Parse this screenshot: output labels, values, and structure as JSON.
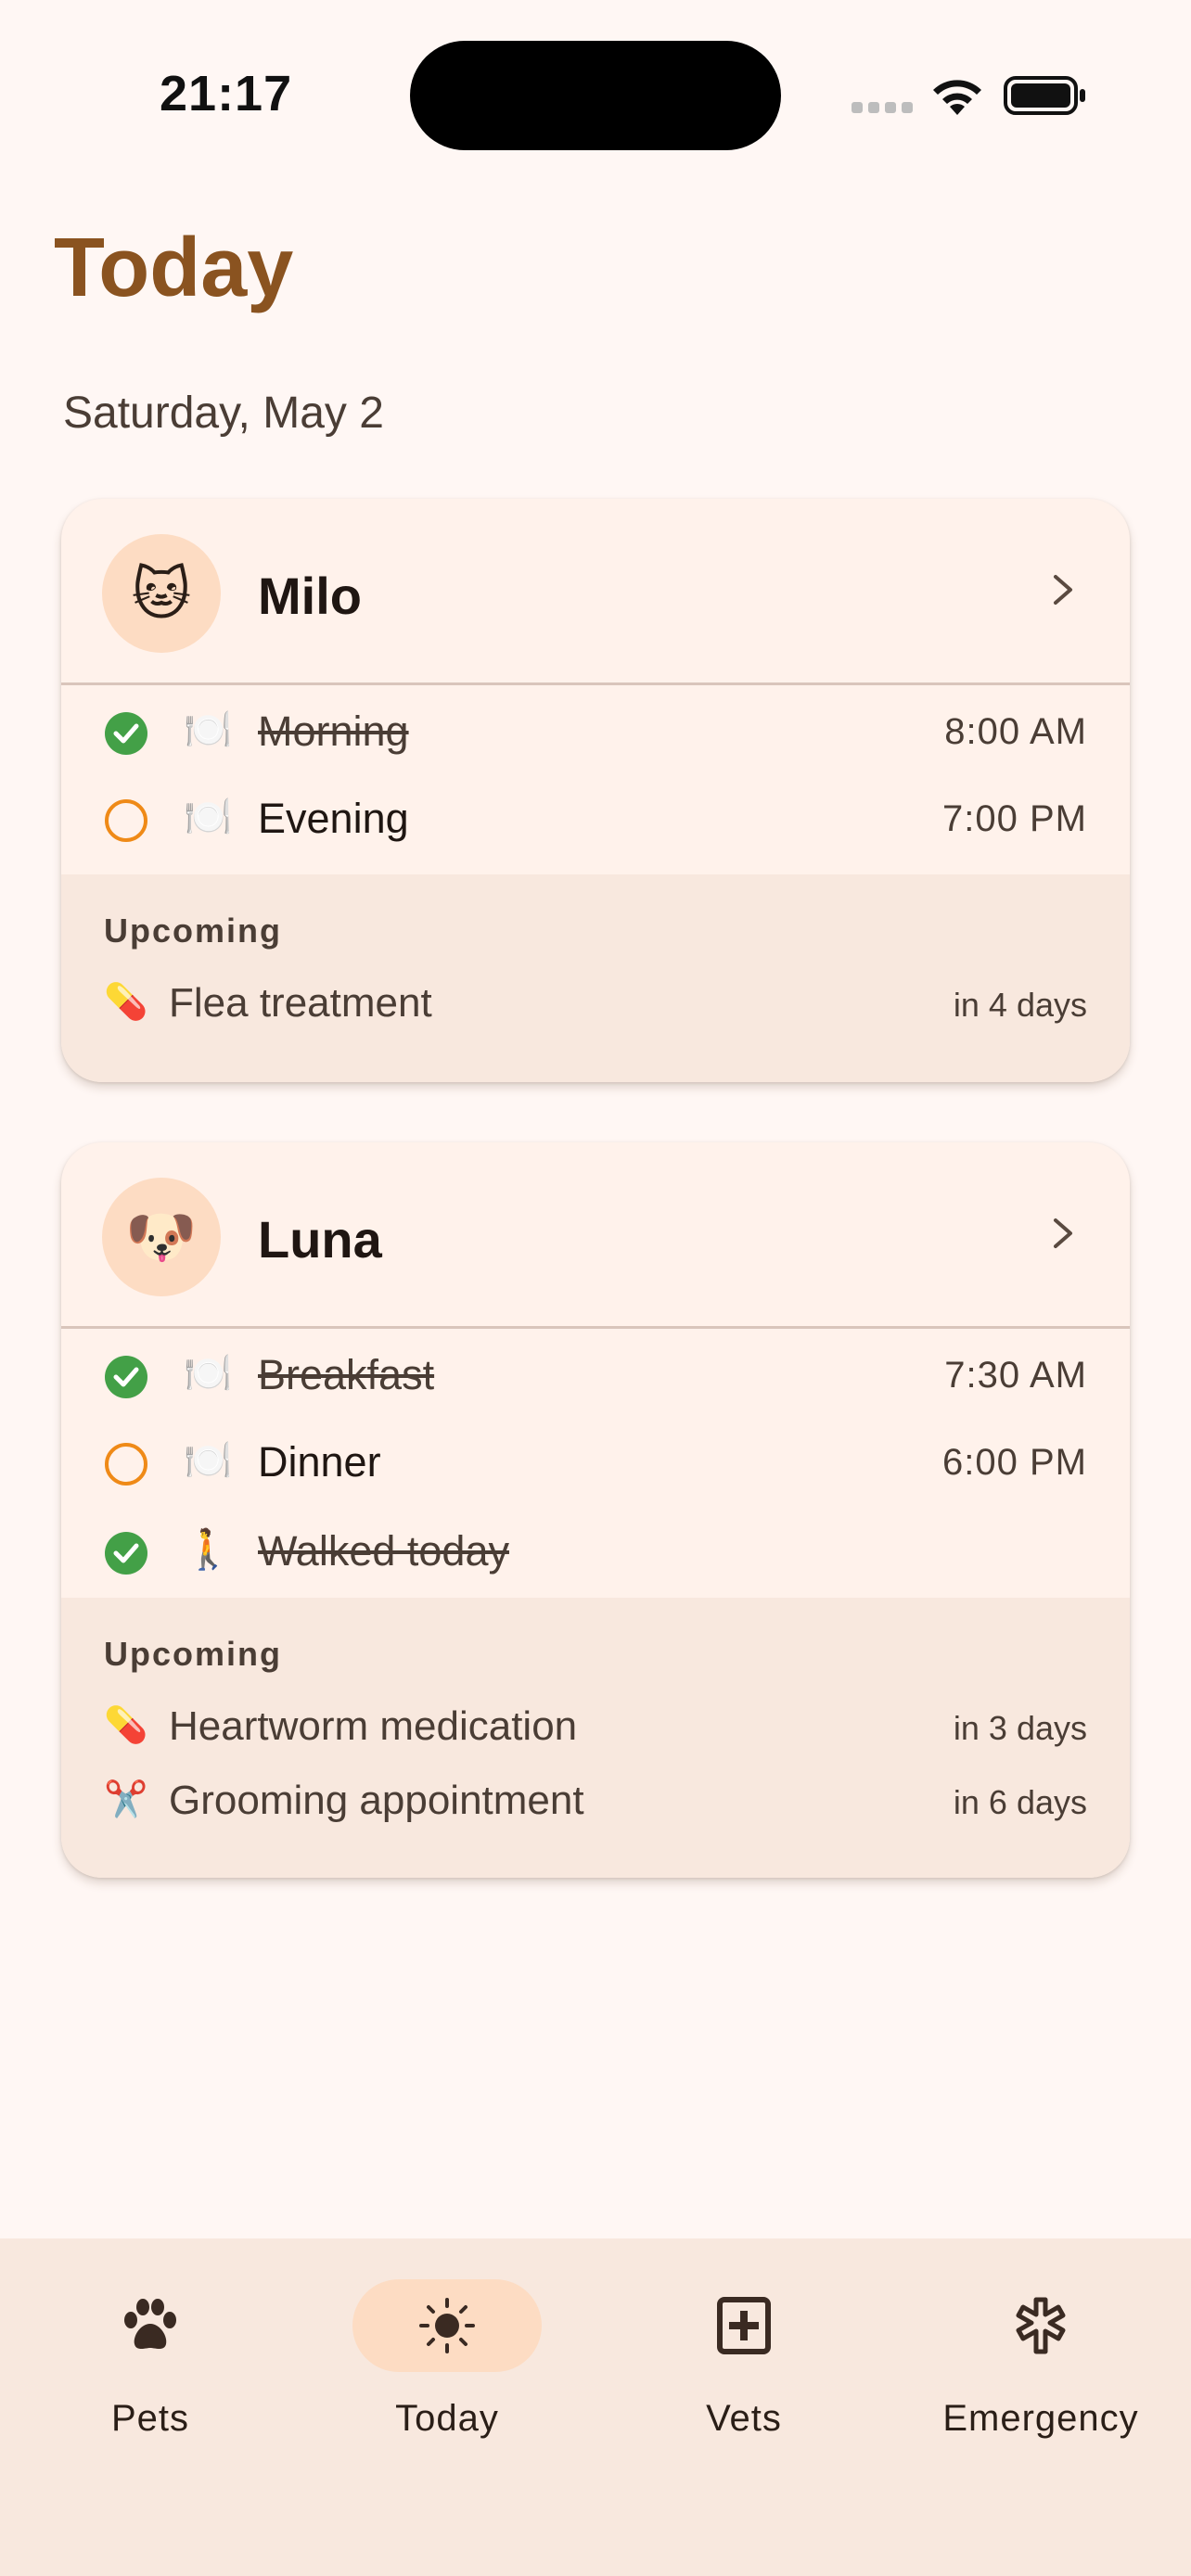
{
  "status": {
    "time": "21:17"
  },
  "page": {
    "title": "Today",
    "date": "Saturday, May 2"
  },
  "pets": [
    {
      "name": "Milo",
      "emoji": "🐱",
      "tasks": [
        {
          "icon": "🍽️",
          "label": "Morning",
          "time": "8:00 AM",
          "done": true
        },
        {
          "icon": "🍽️",
          "label": "Evening",
          "time": "7:00 PM",
          "done": false
        }
      ],
      "upcoming_title": "Upcoming",
      "upcoming": [
        {
          "icon": "💊",
          "label": "Flea treatment",
          "when": "in 4 days"
        }
      ]
    },
    {
      "name": "Luna",
      "emoji": "🐶",
      "tasks": [
        {
          "icon": "🍽️",
          "label": "Breakfast",
          "time": "7:30 AM",
          "done": true
        },
        {
          "icon": "🍽️",
          "label": "Dinner",
          "time": "6:00 PM",
          "done": false
        },
        {
          "icon": "🚶",
          "label": "Walked today",
          "time": "",
          "done": true
        }
      ],
      "upcoming_title": "Upcoming",
      "upcoming": [
        {
          "icon": "💊",
          "label": "Heartworm medication",
          "when": "in 3 days"
        },
        {
          "icon": "✂️",
          "label": "Grooming appointment",
          "when": "in 6 days"
        }
      ]
    }
  ],
  "nav": {
    "items": [
      {
        "label": "Pets",
        "icon": "paw-icon",
        "active": false
      },
      {
        "label": "Today",
        "icon": "sun-icon",
        "active": true
      },
      {
        "label": "Vets",
        "icon": "medical-cross-icon",
        "active": false
      },
      {
        "label": "Emergency",
        "icon": "asterisk-icon",
        "active": false
      }
    ]
  },
  "colors": {
    "accent": "#8A5320",
    "done": "#43A047",
    "pending": "#EF8A17",
    "card": "#FFF2EB",
    "section": "#F8E8DE"
  }
}
